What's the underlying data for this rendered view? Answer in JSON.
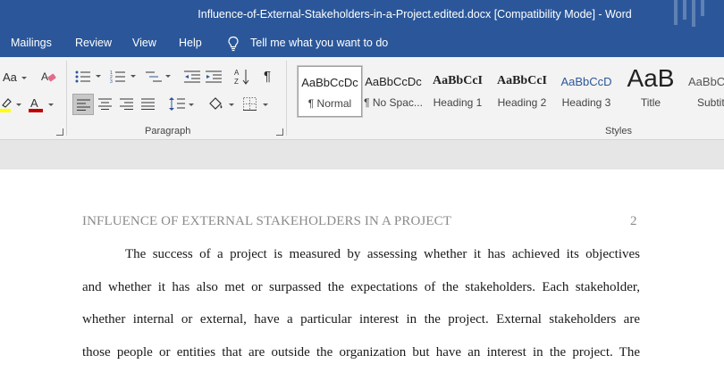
{
  "window": {
    "title": "Influence-of-External-Stakeholders-in-a-Project.edited.docx [Compatibility Mode]  -  Word"
  },
  "tabs": [
    "Mailings",
    "Review",
    "View",
    "Help"
  ],
  "tell_me": "Tell me what you want to do",
  "ribbon": {
    "font_case_label": "Aa",
    "paragraph_group_label": "Paragraph",
    "styles_group_label": "Styles",
    "styles": [
      {
        "preview": "AaBbCcDc",
        "name": "¶ Normal"
      },
      {
        "preview": "AaBbCcDc",
        "name": "¶ No Spac..."
      },
      {
        "preview": "AaBbCcI",
        "name": "Heading 1"
      },
      {
        "preview": "AaBbCcI",
        "name": "Heading 2"
      },
      {
        "preview": "AaBbCcD",
        "name": "Heading 3"
      },
      {
        "preview": "AaB",
        "name": "Title"
      },
      {
        "preview": "AaBbC",
        "name": "Subtit"
      }
    ],
    "colors": {
      "highlight": "#ffff00",
      "font_color": "#c00000",
      "accent": "#2b579a"
    }
  },
  "document": {
    "running_header": "INFLUENCE OF EXTERNAL STAKEHOLDERS IN A PROJECT",
    "page_number": "2",
    "lines": [
      "The success of a project is measured by assessing whether it has achieved its objectives",
      "and whether it has also met or surpassed the expectations of the stakeholders. Each stakeholder,",
      "whether internal or external, have a particular interest in the project. External stakeholders are",
      "those people or entities that are outside the organization but have an interest in the project.  The"
    ]
  }
}
